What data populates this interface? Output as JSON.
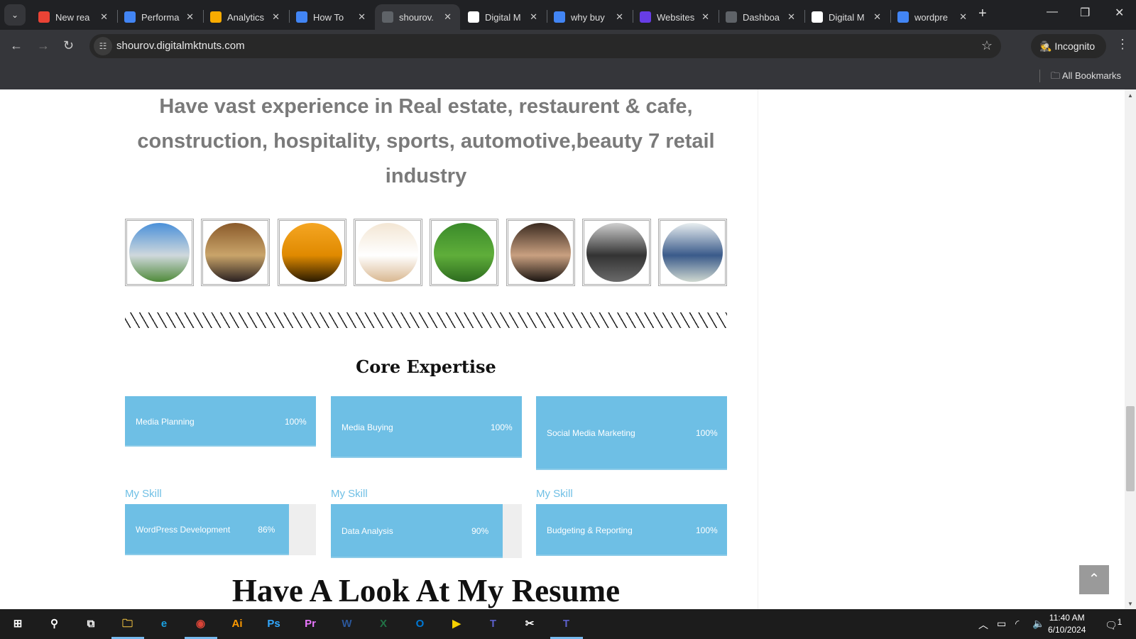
{
  "browser": {
    "tabs": [
      {
        "title": "New rea",
        "icon": "gmail-icon",
        "color": "#ea4335"
      },
      {
        "title": "Performa",
        "icon": "store-icon",
        "color": "#4285f4"
      },
      {
        "title": "Analytics",
        "icon": "analytics-icon",
        "color": "#f9ab00"
      },
      {
        "title": "How To",
        "icon": "docs-icon",
        "color": "#4285f4"
      },
      {
        "title": "shourov.",
        "icon": "globe-icon",
        "color": "#5f6368",
        "active": true
      },
      {
        "title": "Digital M",
        "icon": "page-icon",
        "color": "#ffffff"
      },
      {
        "title": "why buy",
        "icon": "google-icon",
        "color": "#4285f4"
      },
      {
        "title": "Websites",
        "icon": "hostinger-icon",
        "color": "#673de6"
      },
      {
        "title": "Dashboa",
        "icon": "globe-icon",
        "color": "#5f6368"
      },
      {
        "title": "Digital M",
        "icon": "page-icon",
        "color": "#ffffff"
      },
      {
        "title": "wordpre",
        "icon": "google-icon",
        "color": "#4285f4"
      }
    ],
    "url": "shourov.digitalmktnuts.com",
    "incognito_label": "Incognito",
    "bookmarks_label": "All Bookmarks"
  },
  "page": {
    "intro": "Have vast experience in Real estate, restaurent & cafe, construction, hospitality, sports, automotive,beauty 7 retail industry",
    "industry_images": [
      {
        "name": "real-estate",
        "colors": [
          "#4a90d9",
          "#cfd8dc",
          "#4f8a3a"
        ]
      },
      {
        "name": "restaurant-cafe",
        "colors": [
          "#8a5a2a",
          "#c9a46a",
          "#2a2020"
        ]
      },
      {
        "name": "construction",
        "colors": [
          "#f5a623",
          "#e08a00",
          "#2a1a00"
        ]
      },
      {
        "name": "beauty",
        "colors": [
          "#f3e6d4",
          "#ffffff",
          "#d9b891"
        ]
      },
      {
        "name": "sports",
        "colors": [
          "#3a8a2a",
          "#5fae3a",
          "#2d6b1f"
        ]
      },
      {
        "name": "hospitality",
        "colors": [
          "#3a2a20",
          "#c9a080",
          "#1a1410"
        ]
      },
      {
        "name": "automotive",
        "colors": [
          "#cfcfcf",
          "#333333",
          "#6a6a6a"
        ]
      },
      {
        "name": "retail",
        "colors": [
          "#e8eef0",
          "#3a5a8a",
          "#cfd8d0"
        ]
      }
    ],
    "core_title": "Core Expertise",
    "accent": "#6ebfe5",
    "core": [
      {
        "label": "Media Planning",
        "percent": 100,
        "pct_label": "100%"
      },
      {
        "label": "Media Buying",
        "percent": 100,
        "pct_label": "100%"
      },
      {
        "label": "Social Media Marketing",
        "percent": 100,
        "pct_label": "100%"
      }
    ],
    "skills": [
      {
        "heading": "My Skill",
        "label": "WordPress Development",
        "percent": 86,
        "pct_label": "86%"
      },
      {
        "heading": "My Skill",
        "label": "Data Analysis",
        "percent": 90,
        "pct_label": "90%"
      },
      {
        "heading": "My Skill",
        "label": "Budgeting & Reporting",
        "percent": 100,
        "pct_label": "100%"
      }
    ],
    "resume_title": "Have A Look At My Resume"
  },
  "taskbar": {
    "apps": [
      "start",
      "search",
      "task-view",
      "file-explorer",
      "edge",
      "chrome",
      "illustrator",
      "photoshop",
      "premiere",
      "word",
      "excel",
      "outlook",
      "player",
      "teams",
      "capcut",
      "teams-chat"
    ],
    "time": "11:40 AM",
    "date": "6/10/2024",
    "notifications": "1"
  }
}
